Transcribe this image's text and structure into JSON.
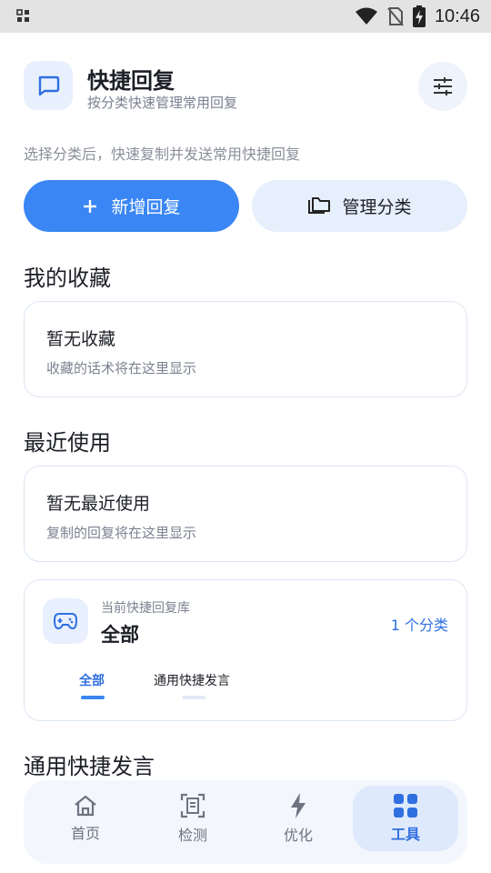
{
  "status_bar": {
    "time": "10:46",
    "icons": [
      "notification-grid-icon",
      "wifi-icon",
      "no-sim-icon",
      "battery-charging-icon"
    ]
  },
  "header": {
    "title": "快捷回复",
    "subtitle": "按分类快速管理常用回复",
    "app_icon": "chat-bubble-icon",
    "filter_icon": "tune-sliders-icon"
  },
  "hint": "选择分类后，快速复制并发送常用快捷回复",
  "actions": {
    "add_label": "新增回复",
    "manage_label": "管理分类"
  },
  "favorites": {
    "title": "我的收藏",
    "empty_title": "暂无收藏",
    "empty_sub": "收藏的话术将在这里显示"
  },
  "recent": {
    "title": "最近使用",
    "empty_title": "暂无最近使用",
    "empty_sub": "复制的回复将在这里显示"
  },
  "library": {
    "label": "当前快捷回复库",
    "name": "全部",
    "count": "1 个分类",
    "icon": "gamepad-icon",
    "tabs": [
      {
        "label": "全部",
        "active": true
      },
      {
        "label": "通用快捷发言",
        "active": false
      }
    ]
  },
  "section_general": {
    "title": "通用快捷发言"
  },
  "bottom_nav": {
    "items": [
      {
        "label": "首页",
        "icon": "home-icon",
        "active": false
      },
      {
        "label": "检测",
        "icon": "scan-document-icon",
        "active": false
      },
      {
        "label": "优化",
        "icon": "lightning-icon",
        "active": false
      },
      {
        "label": "工具",
        "icon": "grid-apps-icon",
        "active": true
      }
    ]
  },
  "colors": {
    "primary": "#3a86f4",
    "primary_text": "#2f6fe0",
    "soft_bg": "#e6effc",
    "card_border": "#dde6f3"
  }
}
